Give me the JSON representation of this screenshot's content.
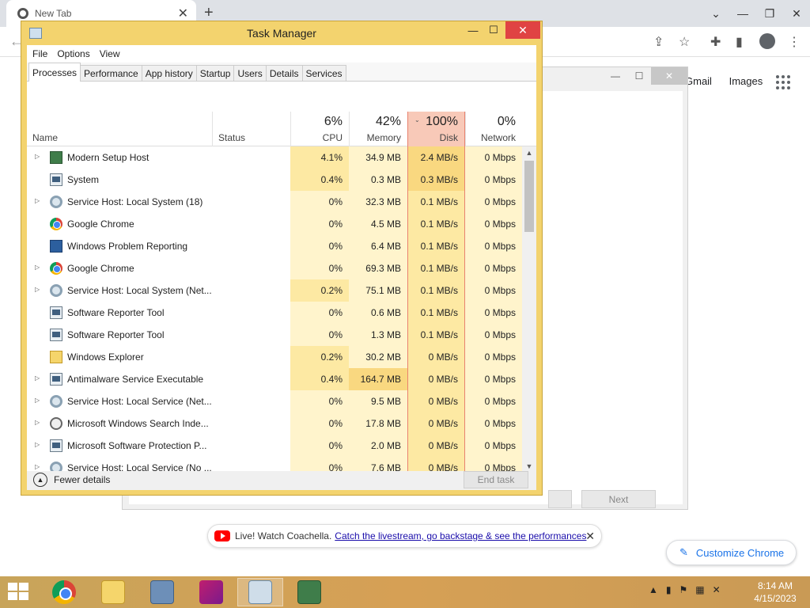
{
  "browser": {
    "tab_title": "New Tab",
    "tab_close": "✕",
    "new_tab": "+",
    "window_controls": [
      "⌄",
      "—",
      "❐",
      "✕"
    ],
    "links": [
      "Gmail",
      "Images"
    ],
    "promo": {
      "text": "Live! Watch Coachella.",
      "link": "Catch the livestream, go backstage & see the performances",
      "close": "✕"
    },
    "customize_label": "Customize Chrome"
  },
  "background_dialog": {
    "next_label": "Next",
    "controls": [
      "—",
      "☐",
      "✕"
    ]
  },
  "taskmgr": {
    "title": "Task Manager",
    "controls": {
      "min": "—",
      "max": "☐",
      "close": "✕"
    },
    "menu": [
      "File",
      "Options",
      "View"
    ],
    "tabs": [
      "Processes",
      "Performance",
      "App history",
      "Startup",
      "Users",
      "Details",
      "Services"
    ],
    "active_tab": "Processes",
    "columns": {
      "name": "Name",
      "status": "Status",
      "cpu": {
        "pct": "6%",
        "label": "CPU"
      },
      "memory": {
        "pct": "42%",
        "label": "Memory"
      },
      "disk": {
        "pct": "100%",
        "label": "Disk"
      },
      "network": {
        "pct": "0%",
        "label": "Network"
      }
    },
    "processes": [
      {
        "name": "Modern Setup Host",
        "expand": true,
        "icon": "setup-icon",
        "cpu": "4.1%",
        "mem": "34.9 MB",
        "disk": "2.4 MB/s",
        "net": "0 Mbps"
      },
      {
        "name": "System",
        "expand": false,
        "icon": "system-icon",
        "cpu": "0.4%",
        "mem": "0.3 MB",
        "disk": "0.3 MB/s",
        "net": "0 Mbps"
      },
      {
        "name": "Service Host: Local System (18)",
        "expand": true,
        "icon": "gear-icon",
        "cpu": "0%",
        "mem": "32.3 MB",
        "disk": "0.1 MB/s",
        "net": "0 Mbps"
      },
      {
        "name": "Google Chrome",
        "expand": false,
        "icon": "chrome-icon",
        "cpu": "0%",
        "mem": "4.5 MB",
        "disk": "0.1 MB/s",
        "net": "0 Mbps"
      },
      {
        "name": "Windows Problem Reporting",
        "expand": false,
        "icon": "report-icon",
        "cpu": "0%",
        "mem": "6.4 MB",
        "disk": "0.1 MB/s",
        "net": "0 Mbps"
      },
      {
        "name": "Google Chrome",
        "expand": true,
        "icon": "chrome-icon",
        "cpu": "0%",
        "mem": "69.3 MB",
        "disk": "0.1 MB/s",
        "net": "0 Mbps"
      },
      {
        "name": "Service Host: Local System (Net...",
        "expand": true,
        "icon": "gear-icon",
        "cpu": "0.2%",
        "mem": "75.1 MB",
        "disk": "0.1 MB/s",
        "net": "0 Mbps"
      },
      {
        "name": "Software Reporter Tool",
        "expand": false,
        "icon": "system-icon",
        "cpu": "0%",
        "mem": "0.6 MB",
        "disk": "0.1 MB/s",
        "net": "0 Mbps"
      },
      {
        "name": "Software Reporter Tool",
        "expand": false,
        "icon": "system-icon",
        "cpu": "0%",
        "mem": "1.3 MB",
        "disk": "0.1 MB/s",
        "net": "0 Mbps"
      },
      {
        "name": "Windows Explorer",
        "expand": false,
        "icon": "explorer-icon",
        "cpu": "0.2%",
        "mem": "30.2 MB",
        "disk": "0 MB/s",
        "net": "0 Mbps"
      },
      {
        "name": "Antimalware Service Executable",
        "expand": true,
        "icon": "system-icon",
        "cpu": "0.4%",
        "mem": "164.7 MB",
        "disk": "0 MB/s",
        "net": "0 Mbps"
      },
      {
        "name": "Service Host: Local Service (Net...",
        "expand": true,
        "icon": "gear-icon",
        "cpu": "0%",
        "mem": "9.5 MB",
        "disk": "0 MB/s",
        "net": "0 Mbps"
      },
      {
        "name": "Microsoft Windows Search Inde...",
        "expand": true,
        "icon": "search-index-icon",
        "cpu": "0%",
        "mem": "17.8 MB",
        "disk": "0 MB/s",
        "net": "0 Mbps"
      },
      {
        "name": "Microsoft Software Protection P...",
        "expand": true,
        "icon": "system-icon",
        "cpu": "0%",
        "mem": "2.0 MB",
        "disk": "0 MB/s",
        "net": "0 Mbps"
      },
      {
        "name": "Service Host: Local Service (No ...",
        "expand": true,
        "icon": "gear-icon",
        "cpu": "0%",
        "mem": "7.6 MB",
        "disk": "0 MB/s",
        "net": "0 Mbps"
      }
    ],
    "fewer_details": "Fewer details",
    "end_task": "End task"
  },
  "taskbar": {
    "time": "8:14 AM",
    "date": "4/15/2023",
    "apps": [
      "chrome-icon",
      "file-explorer-icon",
      "remote-desktop-icon",
      "feather-app-icon",
      "task-manager-icon",
      "setup-icon"
    ]
  },
  "colors": {
    "tm_frame": "#f3d36e",
    "disk_header": "#f8c9b8",
    "disk_border": "#e8826f",
    "close_red": "#e04343",
    "cell_light": "#fff4cc",
    "cell_med": "#fde9a3",
    "cell_strong": "#f9d880"
  }
}
